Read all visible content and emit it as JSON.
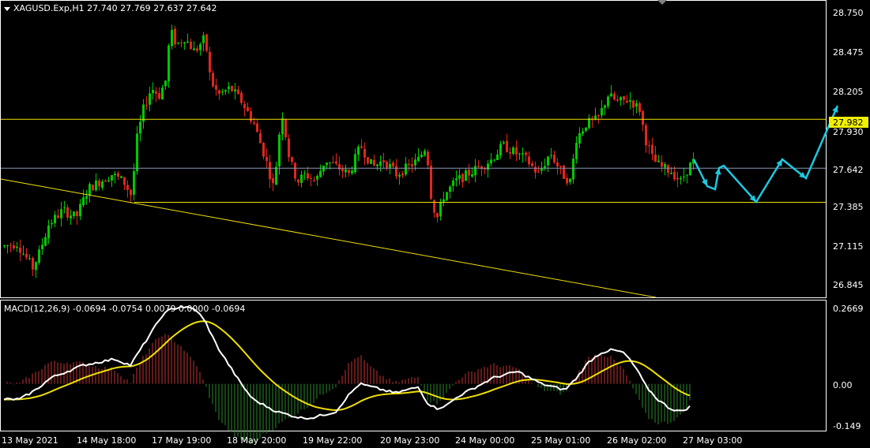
{
  "main_chart": {
    "header_text": "XAGUSD.Exp,H1  27.740 27.769 27.637 27.642",
    "price_labels": [
      "28.750",
      "28.475",
      "28.205",
      "27.930",
      "27.642",
      "27.385",
      "27.115",
      "26.845"
    ],
    "highlight_label": "27.982",
    "current_price_label": "27.642"
  },
  "indicator": {
    "header_text": "MACD(12,26,9) -0.0694 -0.0754 0.0079 0.0000 -0.0694",
    "axis_labels": [
      "0.2669",
      "0.00",
      "-0.149"
    ]
  },
  "time_labels": [
    "13 May 2021",
    "14 May 18:00",
    "17 May 19:00",
    "18 May 20:00",
    "19 May 22:00",
    "20 May 23:00",
    "24 May 00:00",
    "25 May 01:00",
    "26 May 02:00",
    "27 May 03:00"
  ],
  "colors": {
    "background": "#000000",
    "bull": "#00c800",
    "bear": "#e0261d",
    "level_line": "#f0e000",
    "current_line": "#8a96b4",
    "macd_line": "#ffffff",
    "signal_line": "#f0e000",
    "hist_pos": "#c83232",
    "hist_neg": "#2a8a2a",
    "forecast": "#1ec8e0",
    "highlight_bg": "#f0f000"
  },
  "chart_data": {
    "type": "candlestick",
    "symbol": "XAGUSD.Exp",
    "timeframe": "H1",
    "last_ohlc": [
      27.74,
      27.769,
      27.637,
      27.642
    ],
    "ylim": [
      26.75,
      28.8
    ],
    "yticks": [
      28.75,
      28.475,
      28.205,
      27.93,
      27.642,
      27.385,
      27.115,
      26.845
    ],
    "horizontal_levels": [
      27.982,
      27.405
    ],
    "current_price": 27.642,
    "macd_params": "12,26,9",
    "macd_ylim": [
      -0.149,
      0.2669
    ],
    "macd_yticks": [
      0.2669,
      0.0,
      -0.149
    ],
    "x_categories": [
      "13 May 2021",
      "14 May 18:00",
      "17 May 19:00",
      "18 May 20:00",
      "19 May 22:00",
      "20 May 23:00",
      "24 May 00:00",
      "25 May 01:00",
      "26 May 02:00",
      "27 May 03:00"
    ]
  }
}
